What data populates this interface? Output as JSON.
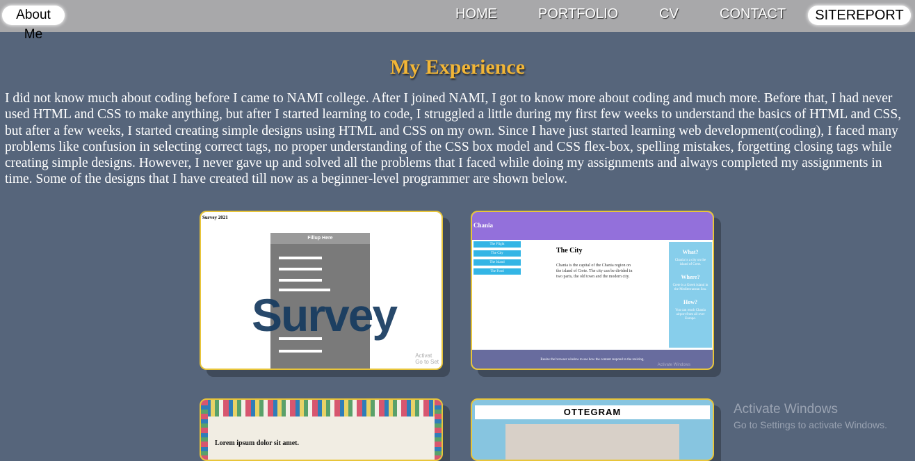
{
  "nav": {
    "about": "About Me",
    "links": [
      "HOME",
      "PORTFOLIO",
      "CV",
      "CONTACT"
    ],
    "sitereport": "SITEREPORT"
  },
  "main": {
    "title": "My Experience",
    "intro": "I did not know much about coding before I came to NAMI college. After I joined NAMI, I got to know more about coding and much more. Before that, I had never used HTML and CSS to make anything, but after I started learning to code, I struggled a little during my first few weeks to understand the basics of HTML and CSS, but after a few weeks, I started creating simple designs using HTML and CSS on my own. Since I have just started learning web development(coding), I faced many problems like confusion in selecting correct tags, no proper understanding of the CSS box model and CSS flex-box, spelling mistakes, forgetting closing tags while creating simple designs. However, I never gave up and solved all the problems that I faced while doing my assignments and always completed my assignments in time. Some of the designs that I have created till now as a beginner-level programmer are shown below."
  },
  "cards": {
    "survey": {
      "page_title": "Survey 2021",
      "form_header": "Fillup Here",
      "big_word": "Survey",
      "activate_line1": "Activat",
      "activate_line2": "Go to Set"
    },
    "chania": {
      "header": "Chania",
      "menu": [
        "The Flight",
        "The City",
        "The Island",
        "The Food"
      ],
      "city_title": "The City",
      "city_text": "Chania is the capital of the Chania region on the island of Crete. The city can be divided in two parts, the old town and the modern city.",
      "aside": [
        {
          "heading": "What?",
          "text": "Chania is a city on the island of Crete."
        },
        {
          "heading": "Where?",
          "text": "Crete is a Greek island in the Mediterranean Sea."
        },
        {
          "heading": "How?",
          "text": "You can reach Chania airport from all over Europe."
        }
      ],
      "footer": "Resize the browser window to see how the content respond to the resizing.",
      "activate": "Activate Windows"
    },
    "lorem": {
      "text": "Lorem ipsum dolor sit amet."
    },
    "ottegram": {
      "title": "OTTEGRAM"
    }
  },
  "watermark": {
    "title": "Activate Windows",
    "sub": "Go to Settings to activate Windows."
  }
}
